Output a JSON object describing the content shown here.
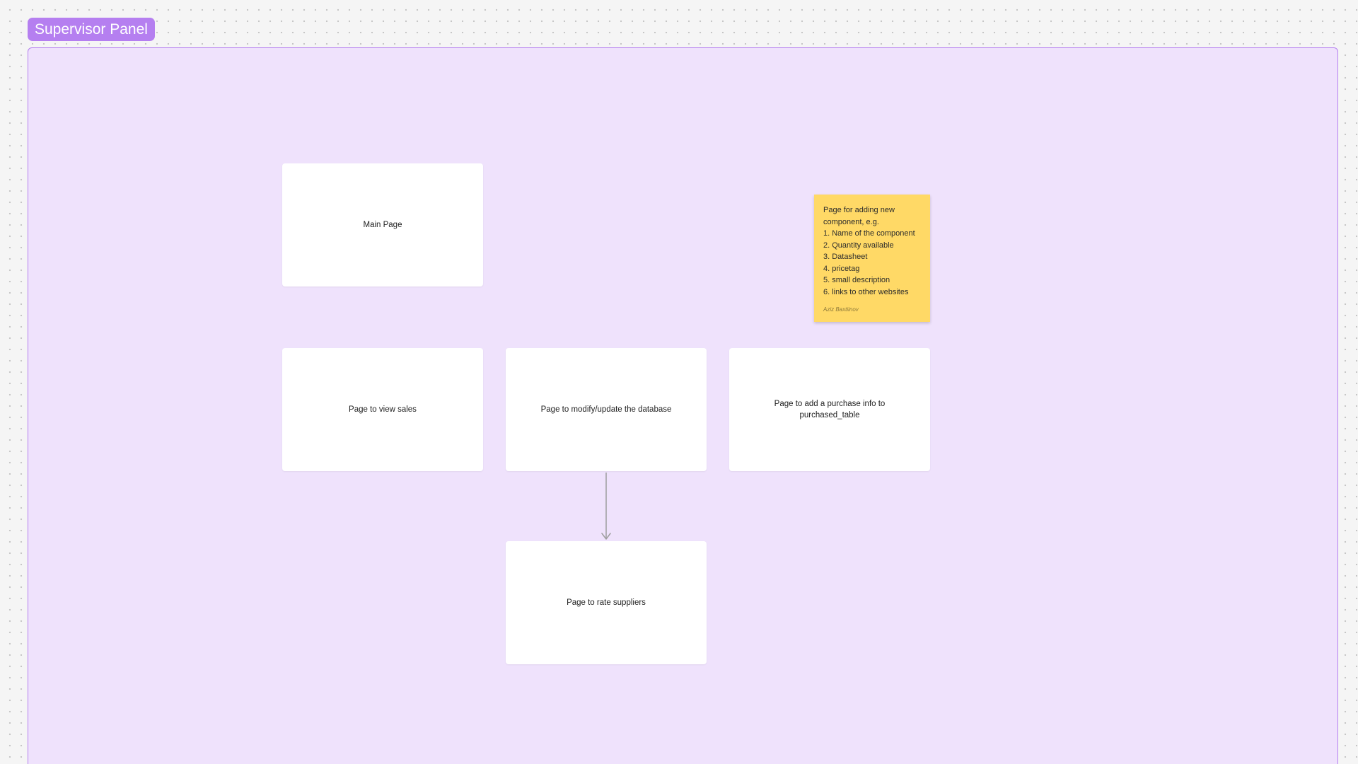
{
  "board": {
    "section_title": "Supervisor Panel",
    "section_color": "#b57ff0",
    "section_fill": "#efe2fc"
  },
  "cards": {
    "main_page": "Main Page",
    "view_sales": "Page to view sales",
    "modify_database": "Page to modify/update the database",
    "add_purchase": "Page to add a purchase info to purchased_table",
    "rate_suppliers": "Page to rate suppliers"
  },
  "sticky_note": {
    "color": "#ffd966",
    "lines": [
      "Page for adding new",
      "component, e.g.",
      "1. Name of the component",
      "2. Quantity available",
      "3. Datasheet",
      "4. pricetag",
      "5. small description",
      "6. links to other websites"
    ],
    "author": "Aziz Baxtiinov"
  },
  "connectors": [
    {
      "from": "modify_database",
      "to": "rate_suppliers",
      "arrow": "arrow-down-icon",
      "color": "#9e9e9e"
    }
  ]
}
